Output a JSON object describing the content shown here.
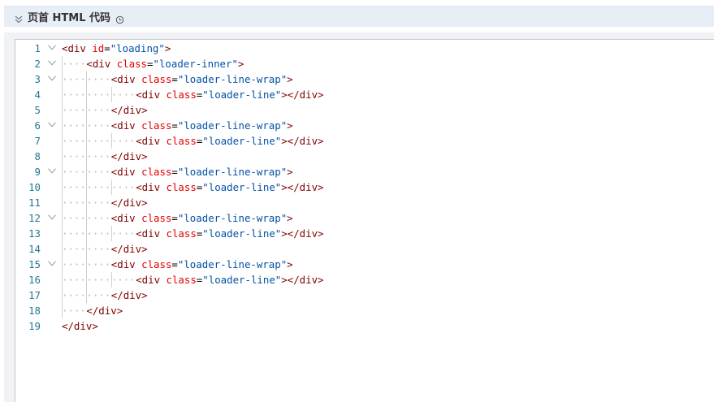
{
  "panel": {
    "title": "页首 HTML 代码",
    "collapse_icon": "double-chevron-down-icon",
    "history_icon": "history-clock-icon"
  },
  "code_lines": [
    {
      "n": "1",
      "fold": true,
      "indent": 0,
      "text": "<div id=\"loading\">"
    },
    {
      "n": "2",
      "fold": true,
      "indent": 1,
      "text": "<div class=\"loader-inner\">"
    },
    {
      "n": "3",
      "fold": true,
      "indent": 2,
      "text": "<div class=\"loader-line-wrap\">"
    },
    {
      "n": "4",
      "fold": false,
      "indent": 3,
      "text": "<div class=\"loader-line\"></div>"
    },
    {
      "n": "5",
      "fold": false,
      "indent": 2,
      "text": "</div>"
    },
    {
      "n": "6",
      "fold": true,
      "indent": 2,
      "text": "<div class=\"loader-line-wrap\">"
    },
    {
      "n": "7",
      "fold": false,
      "indent": 3,
      "text": "<div class=\"loader-line\"></div>"
    },
    {
      "n": "8",
      "fold": false,
      "indent": 2,
      "text": "</div>"
    },
    {
      "n": "9",
      "fold": true,
      "indent": 2,
      "text": "<div class=\"loader-line-wrap\">"
    },
    {
      "n": "10",
      "fold": false,
      "indent": 3,
      "text": "<div class=\"loader-line\"></div>"
    },
    {
      "n": "11",
      "fold": false,
      "indent": 2,
      "text": "</div>"
    },
    {
      "n": "12",
      "fold": true,
      "indent": 2,
      "text": "<div class=\"loader-line-wrap\">"
    },
    {
      "n": "13",
      "fold": false,
      "indent": 3,
      "text": "<div class=\"loader-line\"></div>"
    },
    {
      "n": "14",
      "fold": false,
      "indent": 2,
      "text": "</div>"
    },
    {
      "n": "15",
      "fold": true,
      "indent": 2,
      "text": "<div class=\"loader-line-wrap\">"
    },
    {
      "n": "16",
      "fold": false,
      "indent": 3,
      "text": "<div class=\"loader-line\"></div>"
    },
    {
      "n": "17",
      "fold": false,
      "indent": 2,
      "text": "</div>"
    },
    {
      "n": "18",
      "fold": false,
      "indent": 1,
      "text": "</div>"
    },
    {
      "n": "19",
      "fold": false,
      "indent": 0,
      "text": "</div>"
    }
  ],
  "colors": {
    "tag": "#800000",
    "attribute": "#e50000",
    "value": "#0451a5",
    "line_number": "#237893"
  }
}
